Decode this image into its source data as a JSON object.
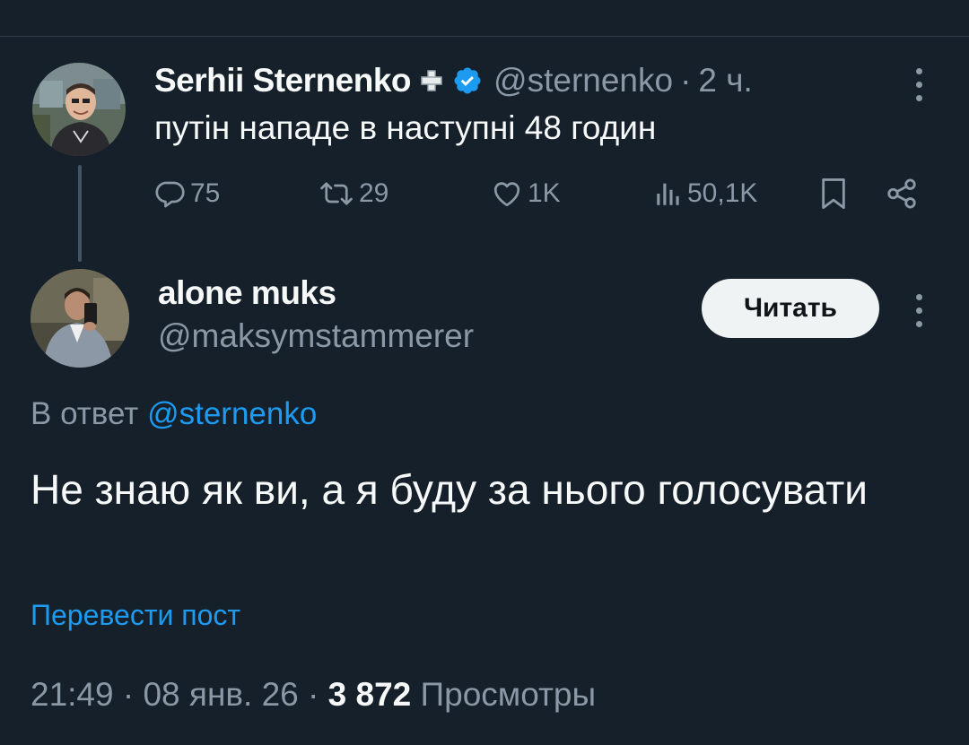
{
  "quoted": {
    "author_name": "Serhii Sternenko",
    "flag_icon": "medical-cross-icon",
    "verified_icon": "verified-badge-icon",
    "handle": "@sternenko",
    "separator": "·",
    "time": "2 ч.",
    "text": "путін нападе в наступні 48 годин",
    "stats": {
      "replies": "75",
      "reposts": "29",
      "likes": "1K",
      "views": "50,1K"
    }
  },
  "reply": {
    "author_name": "alone muks",
    "handle": "@maksymstammerer",
    "follow_label": "Читать",
    "reply_prefix": "В ответ",
    "reply_mention": "@sternenko",
    "text": "Не знаю як ви, а я буду за нього голосувати",
    "translate_label": "Перевести пост",
    "time": "21:49",
    "separator": "·",
    "date": "08 янв. 26",
    "views_count": "3 872",
    "views_label": "Просмотры"
  },
  "colors": {
    "background": "#15202b",
    "accent": "#1d9bf0",
    "muted": "#8b98a5"
  }
}
